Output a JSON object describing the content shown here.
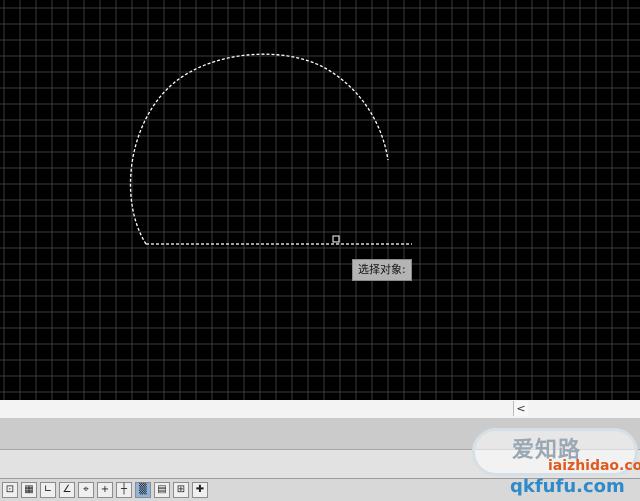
{
  "canvas": {
    "background": "#000000",
    "grid_color": "#3a3a3a",
    "grid_major_color": "#4a4a4a",
    "selection_color": "#ffffff"
  },
  "tooltip": {
    "text": "选择对象:"
  },
  "command_bar": {
    "scroll_arrow": "<"
  },
  "statusbar": {
    "buttons": [
      {
        "name": "snap-icon",
        "glyph": "⊡"
      },
      {
        "name": "grid-icon",
        "glyph": "▦"
      },
      {
        "name": "ortho-icon",
        "glyph": "∟"
      },
      {
        "name": "polar-icon",
        "glyph": "∠"
      },
      {
        "name": "osnap-icon",
        "glyph": "⌖"
      },
      {
        "name": "otrack-icon",
        "glyph": "+"
      },
      {
        "name": "ducs-icon",
        "glyph": "┼"
      },
      {
        "name": "dyn-icon",
        "glyph": "▒"
      },
      {
        "name": "lineweight-icon",
        "glyph": "▤"
      },
      {
        "name": "qp-icon",
        "glyph": "⊞"
      },
      {
        "name": "sc-icon",
        "glyph": "✚"
      }
    ]
  },
  "watermark": {
    "line1": "爱知路",
    "line2": "iaizhidao.com",
    "line3": "qkfufu.com"
  }
}
